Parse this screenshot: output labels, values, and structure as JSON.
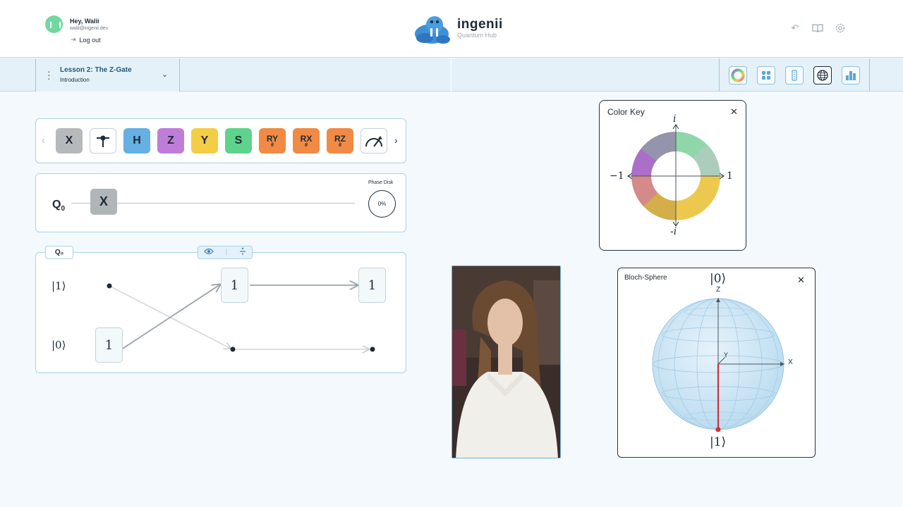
{
  "user": {
    "greeting": "Hey, Walii",
    "email": "walii@ingenii.dev",
    "logout_label": "Log out"
  },
  "brand": {
    "name": "ingenii",
    "subtitle": "Quantum Hub"
  },
  "header_icons": [
    "undo-icon",
    "book-icon",
    "settings-icon"
  ],
  "lesson": {
    "title": "Lesson 2: The Z-Gate",
    "subtitle": "Introduction"
  },
  "toolbar_tools": [
    "color-wheel-tool",
    "grid-tool",
    "list-tool",
    "globe-tool",
    "bar-chart-tool"
  ],
  "gates": [
    {
      "label": "X",
      "color": "#b6b9bb"
    },
    {
      "label": "",
      "name": "control-gate",
      "color": "#ffffff"
    },
    {
      "label": "H",
      "color": "#66b0e3"
    },
    {
      "label": "Z",
      "color": "#c07dd7"
    },
    {
      "label": "Y",
      "color": "#f3cd45"
    },
    {
      "label": "S",
      "color": "#5ed38b"
    },
    {
      "label": "RY",
      "sub": "θ",
      "color": "#f08a45"
    },
    {
      "label": "RX",
      "sub": "θ",
      "color": "#f08a45"
    },
    {
      "label": "RZ",
      "sub": "θ",
      "color": "#f08a45"
    },
    {
      "label": "",
      "name": "measure-gate",
      "color": "#ffffff"
    }
  ],
  "circuit": {
    "qubit_label": "Q",
    "qubit_index": "0",
    "placed_gate": "X",
    "phase_disk_label": "Phase Disk",
    "phase_disk_value": "0%"
  },
  "state_diagram": {
    "tab_label": "Q₀",
    "ket_one": "|1⟩",
    "ket_zero": "|0⟩",
    "input_amplitude": "1",
    "mid_amplitude": "1",
    "output_amplitude": "1"
  },
  "color_key": {
    "title": "Color Key",
    "top": "i",
    "bottom": "-i",
    "left": "−1",
    "right": "1"
  },
  "bloch": {
    "title": "Bloch-Sphere",
    "top_ket": "|0⟩",
    "bottom_ket": "|1⟩",
    "z": "Z",
    "x": "X",
    "y": "Y"
  }
}
